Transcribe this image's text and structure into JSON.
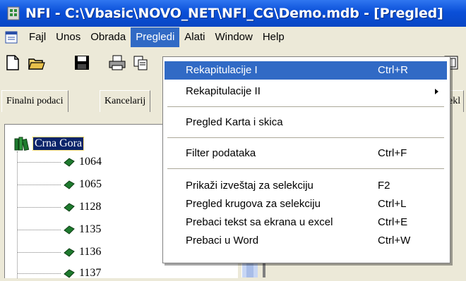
{
  "window": {
    "title": "NFI - C:\\Vbasic\\NOVO_NET\\NFI_CG\\Demo.mdb - [Pregled]"
  },
  "menubar": {
    "items": [
      "Fajl",
      "Unos",
      "Obrada",
      "Pregledi",
      "Alati",
      "Window",
      "Help"
    ],
    "active": "Pregledi"
  },
  "tabs": [
    "Finalni podaci",
    "Kancelarij",
    "ekl"
  ],
  "tree": {
    "root": "Crna Gora",
    "children": [
      "1064",
      "1065",
      "1128",
      "1135",
      "1136",
      "1137"
    ]
  },
  "dropdown": {
    "items": [
      {
        "label": "Rekapitulacije I",
        "shortcut": "Ctrl+R"
      },
      {
        "label": "Rekapitulacije II",
        "shortcut": ""
      },
      {
        "label": "Pregled Karta i skica",
        "shortcut": ""
      },
      {
        "label": "Filter podataka",
        "shortcut": "Ctrl+F"
      },
      {
        "label": "Prikaži izveštaj za selekciju",
        "shortcut": "F2"
      },
      {
        "label": "Pregled krugova za selekciju",
        "shortcut": "Ctrl+L"
      },
      {
        "label": "Prebaci tekst sa ekrana u excel",
        "shortcut": "Ctrl+E"
      },
      {
        "label": "Prebaci u Word",
        "shortcut": "Ctrl+W"
      }
    ]
  },
  "colors": {
    "titlebar": "#0a4fd8",
    "menu_highlight": "#316ac5",
    "tree_selection": "#0a246a",
    "leaf_icon": "#1e7a2e"
  }
}
